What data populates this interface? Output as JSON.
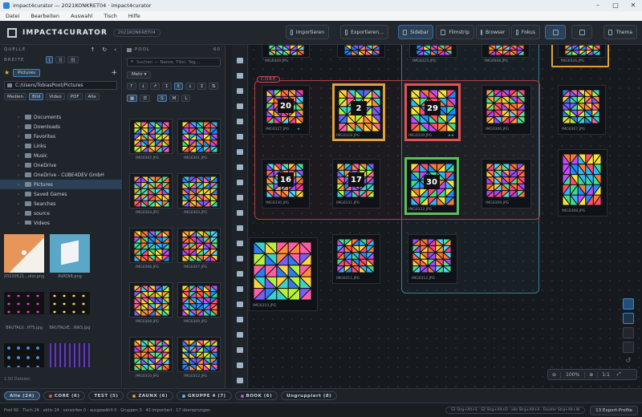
{
  "window": {
    "title": "impact4curator — 2021KONKRET04 · impact4curator"
  },
  "menu": [
    "Datei",
    "Bearbeiten",
    "Auswahl",
    "Tisch",
    "Hilfe"
  ],
  "header": {
    "app_name": "IMPACT4CURATOR",
    "project_tag": "2021KONKRET04",
    "buttons": {
      "import": "Importieren",
      "export": "Exportieren…",
      "sidebar": "Sidebar",
      "filmstrip": "Filmstrip",
      "browser": "Browser",
      "focus": "Fokus",
      "theme": "Thema"
    }
  },
  "source_panel": {
    "title": "QUELLE",
    "width_label": "BREITE",
    "location": "Pictures",
    "path": "C:/Users/TobiasPoot/Pictures",
    "filters": [
      "Medien",
      "Bild",
      "Video",
      "PDF",
      "Alle"
    ],
    "active_filter": "Bild",
    "tree": [
      {
        "label": "Documents",
        "selected": false
      },
      {
        "label": "Downloads",
        "selected": false
      },
      {
        "label": "Favorites",
        "selected": false
      },
      {
        "label": "Links",
        "selected": false
      },
      {
        "label": "Music",
        "selected": false
      },
      {
        "label": "OneDrive",
        "selected": false
      },
      {
        "label": "OneDrive - CUBE4DEV GmbH",
        "selected": false
      },
      {
        "label": "Pictures",
        "selected": true
      },
      {
        "label": "Saved Games",
        "selected": false
      },
      {
        "label": "Searches",
        "selected": false
      },
      {
        "label": "source",
        "selected": false
      },
      {
        "label": "Videos",
        "selected": false
      }
    ],
    "files": [
      {
        "name": "20220521...olor.png"
      },
      {
        "name": "AVATAR.png"
      },
      {
        "name": "BRUTALV...HTS.jpg"
      },
      {
        "name": "BRUTALVE...INKS.jpg"
      }
    ],
    "footer": "1.50 Dateien"
  },
  "pool": {
    "title": "POOL",
    "count": "60",
    "search_placeholder": "Suchen — Name, Titel, Tag…",
    "more_label": "Mehr",
    "sizes": [
      "S",
      "M",
      "L"
    ],
    "items": [
      "IMG0302.JPG",
      "IMG0301.JPG",
      "IMG0304.JPG",
      "IMG0303.JPG",
      "IMG0306.JPG",
      "IMG0307.JPG",
      "IMG0308.JPG",
      "IMG0309.JPG",
      "IMG0310.JPG",
      "IMG0312.JPG"
    ]
  },
  "canvas": {
    "group_label": "CORE",
    "top_caps": [
      "IMG0309.JPG",
      "IMG0323.JPG",
      "IMG0308.JPG",
      "IMG0326.JPG"
    ],
    "cards": [
      {
        "name": "IMG0327.JPG",
        "number": "20",
        "stars": "★"
      },
      {
        "name": "IMG0328.JPG",
        "number": "2",
        "stars": ""
      },
      {
        "name": "IMG0329.JPG",
        "number": "29",
        "stars": "★★"
      },
      {
        "name": "IMG0306.JPG",
        "number": "",
        "stars": ""
      },
      {
        "name": "IMG0307.JPG",
        "number": "",
        "stars": ""
      },
      {
        "name": "IMG0308.JPG",
        "number": "",
        "stars": ""
      },
      {
        "name": "IMG0330.JPG",
        "number": "16",
        "stars": ""
      },
      {
        "name": "IMG0331.JPG",
        "number": "17",
        "stars": ""
      },
      {
        "name": "IMG0332.JPG",
        "number": "30",
        "stars": ""
      },
      {
        "name": "IMG0309.JPG",
        "number": "",
        "stars": ""
      },
      {
        "name": "IMG0310.JPG",
        "number": "",
        "stars": ""
      },
      {
        "name": "IMG0311.JPG",
        "number": "",
        "stars": ""
      },
      {
        "name": "IMG0312.JPG",
        "number": "",
        "stars": ""
      }
    ],
    "zoom": "100%",
    "zoom_fit": "1:1"
  },
  "tags": [
    {
      "label": "Alle (24)",
      "color": "",
      "selected": true
    },
    {
      "label": "CORE (6)",
      "color": "#e05353",
      "selected": false
    },
    {
      "label": "TEST (5)",
      "color": "",
      "selected": false
    },
    {
      "label": "ZAUNX (6)",
      "color": "#e0962c",
      "selected": false
    },
    {
      "label": "GRUPPE 4 (7)",
      "color": "#56b8d8",
      "selected": false
    },
    {
      "label": "BOOK (6)",
      "color": "#b05ad8",
      "selected": false
    },
    {
      "label": "Ungruppiert (8)",
      "color": "",
      "selected": false
    }
  ],
  "status": {
    "text": "Pool 60 · Tisch 24 · aktiv 24 · versorfen 0 · ausgewählt 0 · Gruppen 3 · 43 importiert · 17 übersprungen",
    "shortcuts": "S1 Strg+Alt+S · S2 Strg+Alt+D · alle Strg+Alt+A · Fenster Strg+Alt+W",
    "export_profiles": "13 Export-Profile"
  },
  "colors": {
    "accent": "#3f86c6",
    "core": "#e05353",
    "gold": "#e0a13a",
    "green": "#5cbf5c",
    "teal": "#56b8d8"
  }
}
